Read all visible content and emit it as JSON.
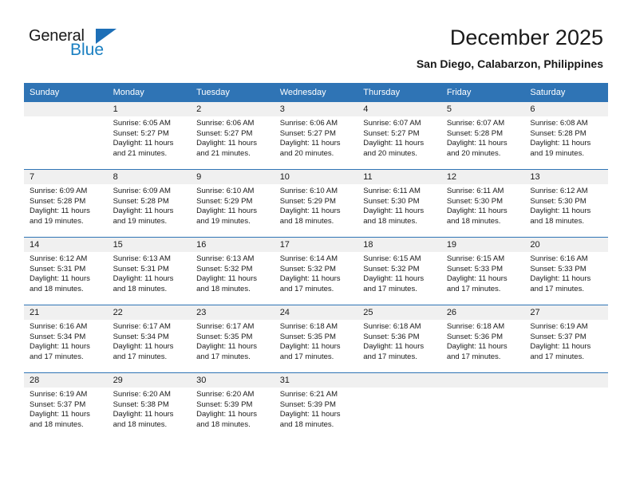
{
  "brand": {
    "word_one": "General",
    "word_two": "Blue",
    "accent_color": "#1d6fb7"
  },
  "header": {
    "title": "December 2025",
    "location": "San Diego, Calabarzon, Philippines"
  },
  "calendar": {
    "header_color": "#2f74b5",
    "weekday_headers": [
      "Sunday",
      "Monday",
      "Tuesday",
      "Wednesday",
      "Thursday",
      "Friday",
      "Saturday"
    ],
    "weeks": [
      [
        {
          "day": "",
          "sunrise": "",
          "sunset": "",
          "daylight_line1": "",
          "daylight_line2": ""
        },
        {
          "day": "1",
          "sunrise": "Sunrise: 6:05 AM",
          "sunset": "Sunset: 5:27 PM",
          "daylight_line1": "Daylight: 11 hours",
          "daylight_line2": "and 21 minutes."
        },
        {
          "day": "2",
          "sunrise": "Sunrise: 6:06 AM",
          "sunset": "Sunset: 5:27 PM",
          "daylight_line1": "Daylight: 11 hours",
          "daylight_line2": "and 21 minutes."
        },
        {
          "day": "3",
          "sunrise": "Sunrise: 6:06 AM",
          "sunset": "Sunset: 5:27 PM",
          "daylight_line1": "Daylight: 11 hours",
          "daylight_line2": "and 20 minutes."
        },
        {
          "day": "4",
          "sunrise": "Sunrise: 6:07 AM",
          "sunset": "Sunset: 5:27 PM",
          "daylight_line1": "Daylight: 11 hours",
          "daylight_line2": "and 20 minutes."
        },
        {
          "day": "5",
          "sunrise": "Sunrise: 6:07 AM",
          "sunset": "Sunset: 5:28 PM",
          "daylight_line1": "Daylight: 11 hours",
          "daylight_line2": "and 20 minutes."
        },
        {
          "day": "6",
          "sunrise": "Sunrise: 6:08 AM",
          "sunset": "Sunset: 5:28 PM",
          "daylight_line1": "Daylight: 11 hours",
          "daylight_line2": "and 19 minutes."
        }
      ],
      [
        {
          "day": "7",
          "sunrise": "Sunrise: 6:09 AM",
          "sunset": "Sunset: 5:28 PM",
          "daylight_line1": "Daylight: 11 hours",
          "daylight_line2": "and 19 minutes."
        },
        {
          "day": "8",
          "sunrise": "Sunrise: 6:09 AM",
          "sunset": "Sunset: 5:28 PM",
          "daylight_line1": "Daylight: 11 hours",
          "daylight_line2": "and 19 minutes."
        },
        {
          "day": "9",
          "sunrise": "Sunrise: 6:10 AM",
          "sunset": "Sunset: 5:29 PM",
          "daylight_line1": "Daylight: 11 hours",
          "daylight_line2": "and 19 minutes."
        },
        {
          "day": "10",
          "sunrise": "Sunrise: 6:10 AM",
          "sunset": "Sunset: 5:29 PM",
          "daylight_line1": "Daylight: 11 hours",
          "daylight_line2": "and 18 minutes."
        },
        {
          "day": "11",
          "sunrise": "Sunrise: 6:11 AM",
          "sunset": "Sunset: 5:30 PM",
          "daylight_line1": "Daylight: 11 hours",
          "daylight_line2": "and 18 minutes."
        },
        {
          "day": "12",
          "sunrise": "Sunrise: 6:11 AM",
          "sunset": "Sunset: 5:30 PM",
          "daylight_line1": "Daylight: 11 hours",
          "daylight_line2": "and 18 minutes."
        },
        {
          "day": "13",
          "sunrise": "Sunrise: 6:12 AM",
          "sunset": "Sunset: 5:30 PM",
          "daylight_line1": "Daylight: 11 hours",
          "daylight_line2": "and 18 minutes."
        }
      ],
      [
        {
          "day": "14",
          "sunrise": "Sunrise: 6:12 AM",
          "sunset": "Sunset: 5:31 PM",
          "daylight_line1": "Daylight: 11 hours",
          "daylight_line2": "and 18 minutes."
        },
        {
          "day": "15",
          "sunrise": "Sunrise: 6:13 AM",
          "sunset": "Sunset: 5:31 PM",
          "daylight_line1": "Daylight: 11 hours",
          "daylight_line2": "and 18 minutes."
        },
        {
          "day": "16",
          "sunrise": "Sunrise: 6:13 AM",
          "sunset": "Sunset: 5:32 PM",
          "daylight_line1": "Daylight: 11 hours",
          "daylight_line2": "and 18 minutes."
        },
        {
          "day": "17",
          "sunrise": "Sunrise: 6:14 AM",
          "sunset": "Sunset: 5:32 PM",
          "daylight_line1": "Daylight: 11 hours",
          "daylight_line2": "and 17 minutes."
        },
        {
          "day": "18",
          "sunrise": "Sunrise: 6:15 AM",
          "sunset": "Sunset: 5:32 PM",
          "daylight_line1": "Daylight: 11 hours",
          "daylight_line2": "and 17 minutes."
        },
        {
          "day": "19",
          "sunrise": "Sunrise: 6:15 AM",
          "sunset": "Sunset: 5:33 PM",
          "daylight_line1": "Daylight: 11 hours",
          "daylight_line2": "and 17 minutes."
        },
        {
          "day": "20",
          "sunrise": "Sunrise: 6:16 AM",
          "sunset": "Sunset: 5:33 PM",
          "daylight_line1": "Daylight: 11 hours",
          "daylight_line2": "and 17 minutes."
        }
      ],
      [
        {
          "day": "21",
          "sunrise": "Sunrise: 6:16 AM",
          "sunset": "Sunset: 5:34 PM",
          "daylight_line1": "Daylight: 11 hours",
          "daylight_line2": "and 17 minutes."
        },
        {
          "day": "22",
          "sunrise": "Sunrise: 6:17 AM",
          "sunset": "Sunset: 5:34 PM",
          "daylight_line1": "Daylight: 11 hours",
          "daylight_line2": "and 17 minutes."
        },
        {
          "day": "23",
          "sunrise": "Sunrise: 6:17 AM",
          "sunset": "Sunset: 5:35 PM",
          "daylight_line1": "Daylight: 11 hours",
          "daylight_line2": "and 17 minutes."
        },
        {
          "day": "24",
          "sunrise": "Sunrise: 6:18 AM",
          "sunset": "Sunset: 5:35 PM",
          "daylight_line1": "Daylight: 11 hours",
          "daylight_line2": "and 17 minutes."
        },
        {
          "day": "25",
          "sunrise": "Sunrise: 6:18 AM",
          "sunset": "Sunset: 5:36 PM",
          "daylight_line1": "Daylight: 11 hours",
          "daylight_line2": "and 17 minutes."
        },
        {
          "day": "26",
          "sunrise": "Sunrise: 6:18 AM",
          "sunset": "Sunset: 5:36 PM",
          "daylight_line1": "Daylight: 11 hours",
          "daylight_line2": "and 17 minutes."
        },
        {
          "day": "27",
          "sunrise": "Sunrise: 6:19 AM",
          "sunset": "Sunset: 5:37 PM",
          "daylight_line1": "Daylight: 11 hours",
          "daylight_line2": "and 17 minutes."
        }
      ],
      [
        {
          "day": "28",
          "sunrise": "Sunrise: 6:19 AM",
          "sunset": "Sunset: 5:37 PM",
          "daylight_line1": "Daylight: 11 hours",
          "daylight_line2": "and 18 minutes."
        },
        {
          "day": "29",
          "sunrise": "Sunrise: 6:20 AM",
          "sunset": "Sunset: 5:38 PM",
          "daylight_line1": "Daylight: 11 hours",
          "daylight_line2": "and 18 minutes."
        },
        {
          "day": "30",
          "sunrise": "Sunrise: 6:20 AM",
          "sunset": "Sunset: 5:39 PM",
          "daylight_line1": "Daylight: 11 hours",
          "daylight_line2": "and 18 minutes."
        },
        {
          "day": "31",
          "sunrise": "Sunrise: 6:21 AM",
          "sunset": "Sunset: 5:39 PM",
          "daylight_line1": "Daylight: 11 hours",
          "daylight_line2": "and 18 minutes."
        },
        {
          "day": "",
          "sunrise": "",
          "sunset": "",
          "daylight_line1": "",
          "daylight_line2": ""
        },
        {
          "day": "",
          "sunrise": "",
          "sunset": "",
          "daylight_line1": "",
          "daylight_line2": ""
        },
        {
          "day": "",
          "sunrise": "",
          "sunset": "",
          "daylight_line1": "",
          "daylight_line2": ""
        }
      ]
    ]
  }
}
